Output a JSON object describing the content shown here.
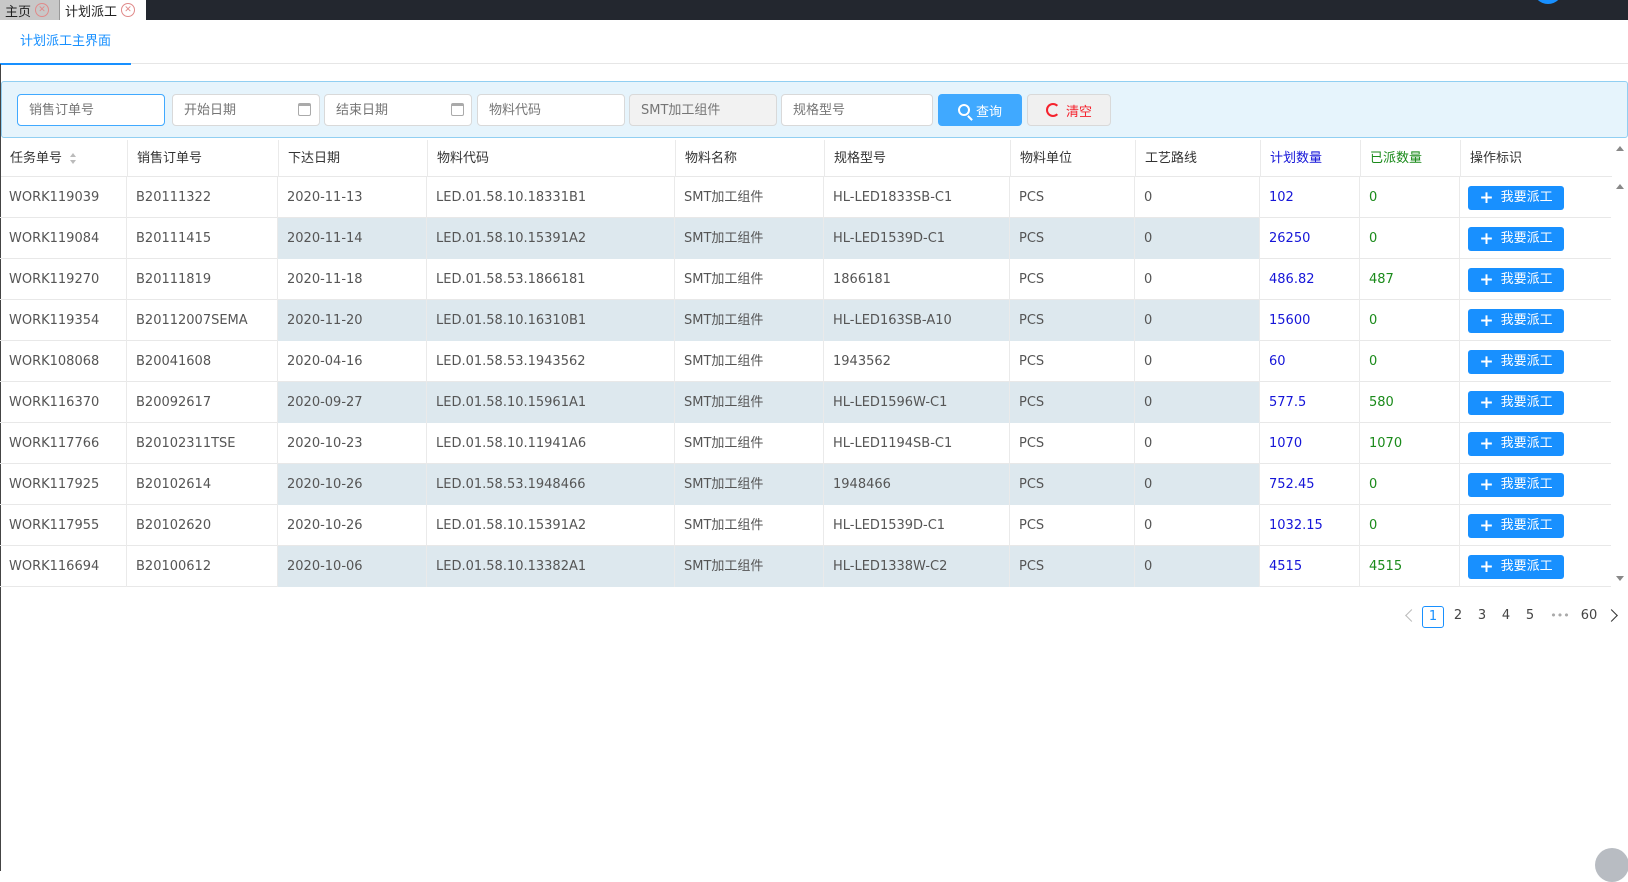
{
  "tabs": [
    {
      "label": "主页",
      "close": "✕"
    },
    {
      "label": "计划派工",
      "close": "✕"
    }
  ],
  "subtab": "计划派工主界面",
  "filters": {
    "sales_order": "销售订单号",
    "start_date": "开始日期",
    "end_date": "结束日期",
    "material_code": "物料代码",
    "material_name": "SMT加工组件",
    "spec": "规格型号",
    "query_label": "查询",
    "clear_label": "清空"
  },
  "columns": [
    "任务单号",
    "销售订单号",
    "下达日期",
    "物料代码",
    "物料名称",
    "规格型号",
    "物料单位",
    "工艺路线",
    "计划数量",
    "已派数量",
    "操作标识"
  ],
  "action_label": "我要派工",
  "rows": [
    {
      "task": "WORK119039",
      "order": "B20111322",
      "date": "2020-11-13",
      "code": "LED.01.58.10.18331B1",
      "name": "SMT加工组件",
      "spec": "HL-LED1833SB-C1",
      "unit": "PCS",
      "route": "0",
      "plan": "102",
      "sent": "0"
    },
    {
      "task": "WORK119084",
      "order": "B20111415",
      "date": "2020-11-14",
      "code": "LED.01.58.10.15391A2",
      "name": "SMT加工组件",
      "spec": "HL-LED1539D-C1",
      "unit": "PCS",
      "route": "0",
      "plan": "26250",
      "sent": "0"
    },
    {
      "task": "WORK119270",
      "order": "B20111819",
      "date": "2020-11-18",
      "code": "LED.01.58.53.1866181",
      "name": "SMT加工组件",
      "spec": "1866181",
      "unit": "PCS",
      "route": "0",
      "plan": "486.82",
      "sent": "487"
    },
    {
      "task": "WORK119354",
      "order": "B20112007SEMA",
      "date": "2020-11-20",
      "code": "LED.01.58.10.16310B1",
      "name": "SMT加工组件",
      "spec": "HL-LED163SB-A10",
      "unit": "PCS",
      "route": "0",
      "plan": "15600",
      "sent": "0"
    },
    {
      "task": "WORK108068",
      "order": "B20041608",
      "date": "2020-04-16",
      "code": "LED.01.58.53.1943562",
      "name": "SMT加工组件",
      "spec": "1943562",
      "unit": "PCS",
      "route": "0",
      "plan": "60",
      "sent": "0"
    },
    {
      "task": "WORK116370",
      "order": "B20092617",
      "date": "2020-09-27",
      "code": "LED.01.58.10.15961A1",
      "name": "SMT加工组件",
      "spec": "HL-LED1596W-C1",
      "unit": "PCS",
      "route": "0",
      "plan": "577.5",
      "sent": "580"
    },
    {
      "task": "WORK117766",
      "order": "B20102311TSE",
      "date": "2020-10-23",
      "code": "LED.01.58.10.11941A6",
      "name": "SMT加工组件",
      "spec": "HL-LED1194SB-C1",
      "unit": "PCS",
      "route": "0",
      "plan": "1070",
      "sent": "1070"
    },
    {
      "task": "WORK117925",
      "order": "B20102614",
      "date": "2020-10-26",
      "code": "LED.01.58.53.1948466",
      "name": "SMT加工组件",
      "spec": "1948466",
      "unit": "PCS",
      "route": "0",
      "plan": "752.45",
      "sent": "0"
    },
    {
      "task": "WORK117955",
      "order": "B20102620",
      "date": "2020-10-26",
      "code": "LED.01.58.10.15391A2",
      "name": "SMT加工组件",
      "spec": "HL-LED1539D-C1",
      "unit": "PCS",
      "route": "0",
      "plan": "1032.15",
      "sent": "0"
    },
    {
      "task": "WORK116694",
      "order": "B20100612",
      "date": "2020-10-06",
      "code": "LED.01.58.10.13382A1",
      "name": "SMT加工组件",
      "spec": "HL-LED1338W-C2",
      "unit": "PCS",
      "route": "0",
      "plan": "4515",
      "sent": "4515"
    }
  ],
  "pagination": {
    "pages": [
      "1",
      "2",
      "3",
      "4",
      "5"
    ],
    "ellipsis": "•••",
    "last": "60",
    "current": "1"
  },
  "colors": {
    "accent": "#1890ff",
    "plan": "#1515d8",
    "sent": "#1a8a1a",
    "clear": "#f5222d"
  }
}
